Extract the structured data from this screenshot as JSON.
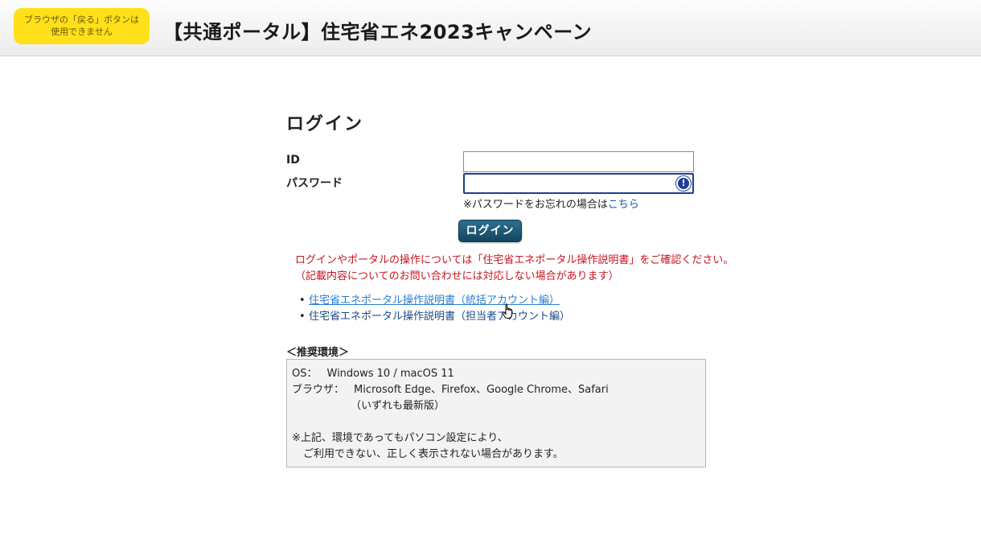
{
  "header": {
    "back_note_line1": "ブラウザの「戻る」ボタンは",
    "back_note_line2": "使用できません",
    "title": "【共通ポータル】住宅省エネ2023キャンペーン"
  },
  "login": {
    "title": "ログイン",
    "id_label": "ID",
    "password_label": "パスワード",
    "id_value": "",
    "password_value": "",
    "password_manager_icon": "onepassword-icon",
    "forgot_prefix": "※パスワードをお忘れの場合は",
    "forgot_link": "こちら",
    "button_label": "ログイン"
  },
  "notice": {
    "line1": "ログインやポータルの操作については「住宅省エネポータル操作説明書」をご確認ください。",
    "line2": "（記載内容についてのお問い合わせには対応しない場合があります）"
  },
  "manuals": [
    {
      "label": "住宅省エネポータル操作説明書（統括アカウント編）"
    },
    {
      "label": "住宅省エネポータル操作説明書（担当者アカウント編）"
    }
  ],
  "environment": {
    "title": "＜推奨環境＞",
    "os_label": "OS：",
    "os_value": "Windows 10 / macOS 11",
    "browser_label": "ブラウザ：",
    "browser_value": "Microsoft Edge、Firefox、Google Chrome、Safari",
    "browser_note": "（いずれも最新版）",
    "caution_line1": "※上記、環境であってもパソコン設定により、",
    "caution_line2": "ご利用できない、正しく表示されない場合があります。"
  },
  "colors": {
    "notice_red": "#c8141e",
    "link_blue": "#1a55a8",
    "button_teal": "#1f5a78",
    "back_note_yellow": "#ffe01a"
  }
}
